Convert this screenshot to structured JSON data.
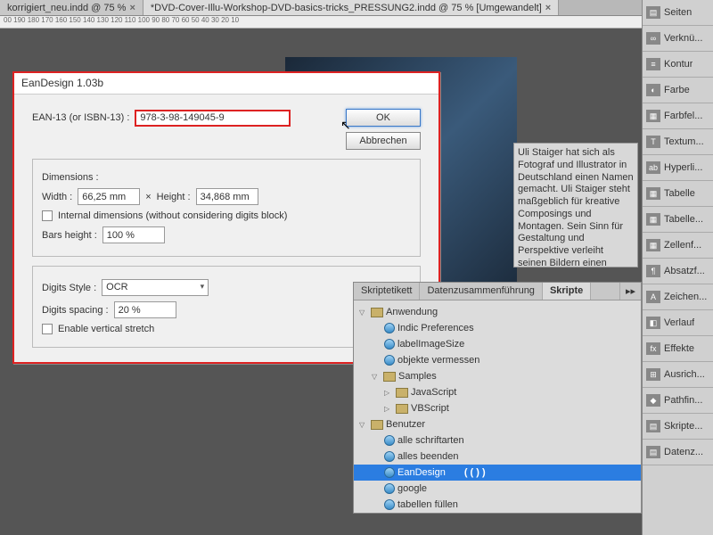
{
  "tabs": {
    "doc1": "korrigiert_neu.indd @ 75 %",
    "doc2": "*DVD-Cover-Illu-Workshop-DVD-basics-tricks_PRESSUNG2.indd @ 75 % [Umgewandelt]"
  },
  "ruler": "00  190  180  170  160  150  140  130  120  110  100  90  80  70  60  50  40  30  20  10",
  "dialog": {
    "title": "EanDesign 1.03b",
    "ean_label": "EAN-13 (or ISBN-13) :",
    "ean_value": "978-3-98-149045-9",
    "ok": "OK",
    "cancel": "Abbrechen",
    "dim_heading": "Dimensions :",
    "width_label": "Width :",
    "width_value": "66,25 mm",
    "times": "×",
    "height_label": "Height :",
    "height_value": "34,868 mm",
    "internal_cb": "Internal dimensions (without considering digits block)",
    "bars_label": "Bars height :",
    "bars_value": "100 %",
    "digits_style_label": "Digits Style :",
    "digits_style_value": "OCR",
    "digits_spacing_label": "Digits spacing :",
    "digits_spacing_value": "20 %",
    "vertical_cb": "Enable vertical stretch"
  },
  "description": "Uli Staiger hat sich als Fotograf und Illustrator in Deutschland einen Namen gemacht. Uli Staiger steht maßgeblich für kreative Composings und Montagen. Sein Sinn für Gestaltung und Perspektive verleiht seinen Bildern einen wiedererkennbaren Stil. Als Vorreiter zeigt Uli Staiger bereits jetzt, wo unter Einbeziehung von CINEMA 4D ein weiterer Weg für fantastische Composings und Montagen hingehen wird.",
  "scripts": {
    "tab1": "Skriptetikett",
    "tab2": "Datenzusammenführung",
    "tab3": "Skripte",
    "more": "▸▸",
    "tree": {
      "anwendung": "Anwendung",
      "indic": "Indic Preferences",
      "labelimg": "labelImageSize",
      "objekte": "objekte vermessen",
      "samples": "Samples",
      "js": "JavaScript",
      "vbs": "VBScript",
      "benutzer": "Benutzer",
      "alle_schrift": "alle schriftarten",
      "alles_beenden": "alles beenden",
      "eandesign": "EanDesign",
      "paren": "( ( ) )",
      "google": "google",
      "tabellen": "tabellen füllen"
    }
  },
  "panels": [
    {
      "label": "Seiten",
      "icon": "▤"
    },
    {
      "label": "Verknü...",
      "icon": "∞"
    },
    {
      "label": "Kontur",
      "icon": "≡"
    },
    {
      "label": "Farbe",
      "icon": "◐"
    },
    {
      "label": "Farbfel...",
      "icon": "▦"
    },
    {
      "label": "Textum...",
      "icon": "T"
    },
    {
      "label": "Hyperli...",
      "icon": "ab"
    },
    {
      "label": "Tabelle",
      "icon": "▦"
    },
    {
      "label": "Tabelle...",
      "icon": "▦"
    },
    {
      "label": "Zellenf...",
      "icon": "▦"
    },
    {
      "label": "Absatzf...",
      "icon": "¶"
    },
    {
      "label": "Zeichen...",
      "icon": "A"
    },
    {
      "label": "Verlauf",
      "icon": "◧"
    },
    {
      "label": "Effekte",
      "icon": "fx"
    },
    {
      "label": "Ausrich...",
      "icon": "⊞"
    },
    {
      "label": "Pathfin...",
      "icon": "◆"
    },
    {
      "label": "Skripte...",
      "icon": "▤"
    },
    {
      "label": "Datenz...",
      "icon": "▤"
    }
  ]
}
